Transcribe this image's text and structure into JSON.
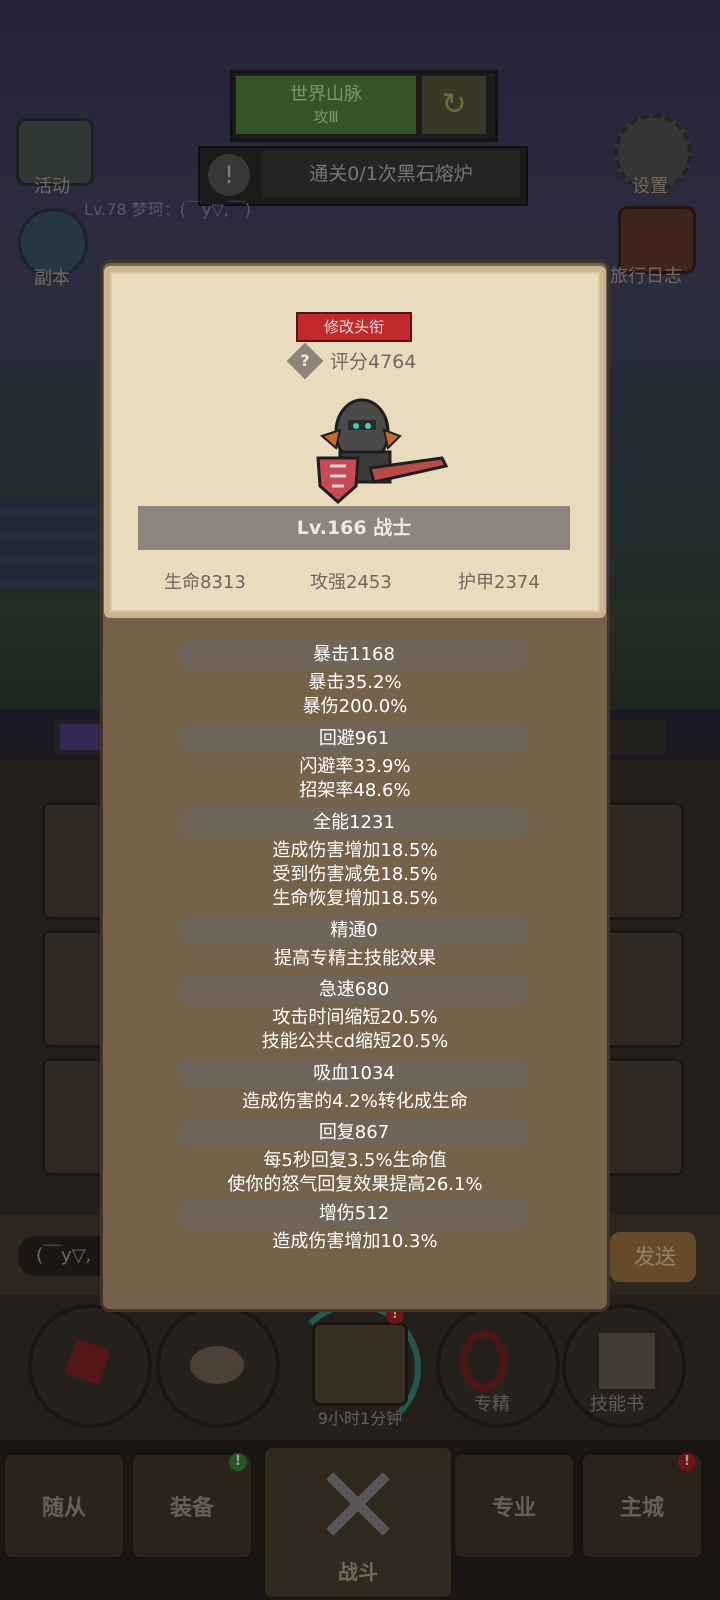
{
  "hud": {
    "world_boss_line1": "世界山脉",
    "world_boss_line2": "攻Ⅲ",
    "quest_text": "通关0/1次黑石熔炉",
    "player_line": "Lv.78 梦珂：(￣y▽,￣)",
    "left_icons": [
      {
        "label": "活动"
      },
      {
        "label": "副本"
      }
    ],
    "right_icons": [
      {
        "label": "设置"
      },
      {
        "label": "旅行日志"
      }
    ]
  },
  "chat": {
    "input_value": "(￣y▽,",
    "send_label": "发送"
  },
  "action_bar": {
    "timer": "9小时1分钟",
    "specialty_label": "专精",
    "skillbook_label": "技能书"
  },
  "bottom_nav": {
    "items": [
      {
        "label": "随从"
      },
      {
        "label": "装备"
      },
      {
        "label": "战斗"
      },
      {
        "label": "专业"
      },
      {
        "label": "主城"
      }
    ]
  },
  "panel": {
    "title_button": "修改头衔",
    "score": "评分4764",
    "class_line": "Lv.166 战士",
    "main_stats": {
      "hp": "生命8313",
      "attack": "攻强2453",
      "armor": "护甲2374"
    },
    "sections": [
      {
        "header": "暴击1168",
        "lines": [
          "暴击35.2%",
          "暴伤200.0%"
        ]
      },
      {
        "header": "回避961",
        "lines": [
          "闪避率33.9%",
          "招架率48.6%"
        ]
      },
      {
        "header": "全能1231",
        "lines": [
          "造成伤害增加18.5%",
          "受到伤害减免18.5%",
          "生命恢复增加18.5%"
        ]
      },
      {
        "header": "精通0",
        "lines": [
          "提高专精主技能效果"
        ]
      },
      {
        "header": "急速680",
        "lines": [
          "攻击时间缩短20.5%",
          "技能公共cd缩短20.5%"
        ]
      },
      {
        "header": "吸血1034",
        "lines": [
          "造成伤害的4.2%转化成生命"
        ]
      },
      {
        "header": "回复867",
        "lines": [
          "每5秒回复3.5%生命值",
          "使你的怒气回复效果提高26.1%"
        ]
      },
      {
        "header": "增伤512",
        "lines": [
          "造成伤害增加10.3%"
        ]
      }
    ]
  },
  "colors": {
    "title_button": "#c12a2a",
    "panel_parchment": "#e9dcbe",
    "panel_body": "#75624b",
    "stat_header": "#6f6558"
  }
}
